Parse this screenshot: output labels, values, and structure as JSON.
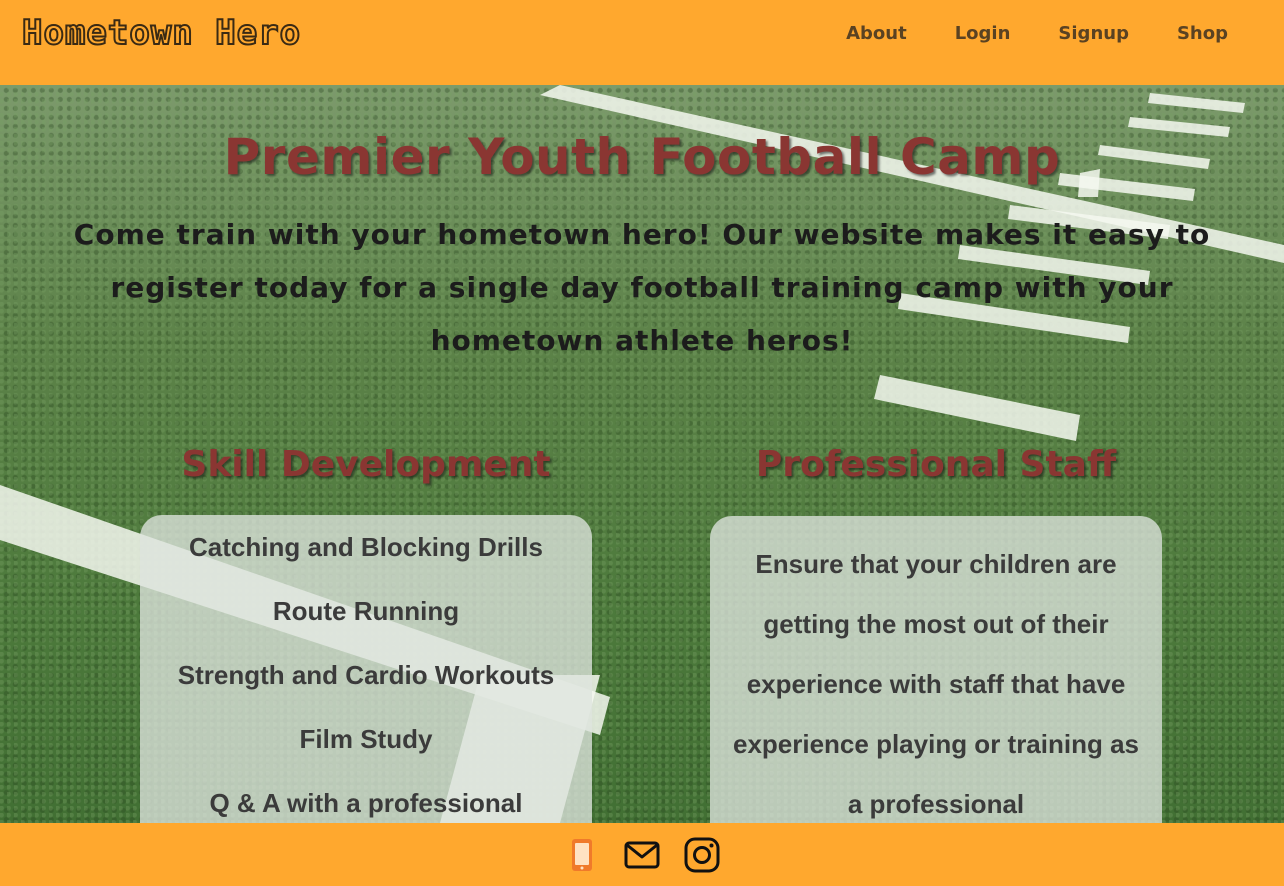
{
  "header": {
    "brand": "Hometown Hero",
    "nav": [
      "About",
      "Login",
      "Signup",
      "Shop"
    ]
  },
  "hero": {
    "title": "Premier Youth Football Camp",
    "subtitle": "Come train with your hometown hero! Our website makes it easy to register today for a single day football training camp with your hometown athlete heros!"
  },
  "skills": {
    "heading": "Skill Development",
    "items": [
      "Catching and Blocking Drills",
      "Route Running",
      "Strength and Cardio Workouts",
      "Film Study",
      "Q & A with a professional"
    ]
  },
  "staff": {
    "heading": "Professional Staff",
    "text": "Ensure that your children are getting the most out of their experience with staff that have experience playing or training as a professional"
  },
  "footer": {
    "icons": [
      "phone-icon",
      "mail-icon",
      "instagram-icon"
    ]
  },
  "colors": {
    "header_bg": "#ffa82e",
    "accent_red": "#8a3632",
    "card_bg": "#dee4de"
  }
}
